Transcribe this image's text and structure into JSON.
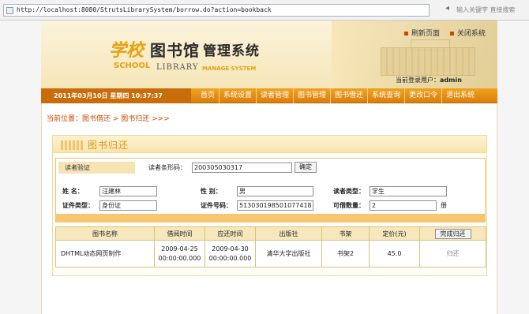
{
  "browser": {
    "url": "http://localhost:8080/StrutsLibrarySystem/borrow.do?action=bookback",
    "search_hint": "输入关键字  直接搜索"
  },
  "header": {
    "logo": {
      "school_cn": "学校",
      "library_cn": "图书馆",
      "system_cn": "管理系统",
      "school_en": "SCHOOL",
      "library_en": "LIBRARY",
      "manage_en": "MANAGE SYSTEM"
    },
    "tools": {
      "refresh": "刷新页面",
      "close": "关闭系统"
    },
    "login_label": "当前登录用户：",
    "login_user": "admin"
  },
  "nav": {
    "datetime": "2011年03月10日  星期四  10:37:37",
    "items": [
      "首页",
      "系统设置",
      "读者管理",
      "图书管理",
      "图书借还",
      "系统查询",
      "更改口令",
      "退出系统"
    ]
  },
  "breadcrumb": {
    "prefix": "当前位置：",
    "level1": "图书借还",
    "sep": " > ",
    "level2": "图书归还",
    "suffix": " >>>"
  },
  "panel": {
    "title": "图书归还",
    "reader_verify": {
      "section_label": "读者验证",
      "barcode_label": "读者条形码：",
      "barcode_value": "200305030317",
      "confirm_button": "确定"
    },
    "reader_info": {
      "name_label": "姓    名：",
      "name_value": "汪建林",
      "gender_label": "性    别：",
      "gender_value": "男",
      "type_label": "读者类型：",
      "type_value": "学生",
      "id_type_label": "证件类型：",
      "id_type_value": "身份证",
      "id_no_label": "证件号码：",
      "id_no_value": "513030198501077418",
      "borrowable_label": "可借数量：",
      "borrowable_value": "2",
      "borrowable_unit": "册"
    },
    "table": {
      "columns": [
        "图书名称",
        "借阅时间",
        "应还时间",
        "出版社",
        "书架",
        "定价(元)"
      ],
      "complete_button": "完成归还",
      "rows": [
        {
          "title": "DHTML动态网页制作",
          "borrow_date": "2009-04-25",
          "borrow_time": "00:00:00.000",
          "due_date": "2009-04-30",
          "due_time": "00:00:00.000",
          "publisher": "清华大学出版社",
          "shelf": "书架2",
          "price": "45.0",
          "action": "归还"
        }
      ]
    }
  }
}
